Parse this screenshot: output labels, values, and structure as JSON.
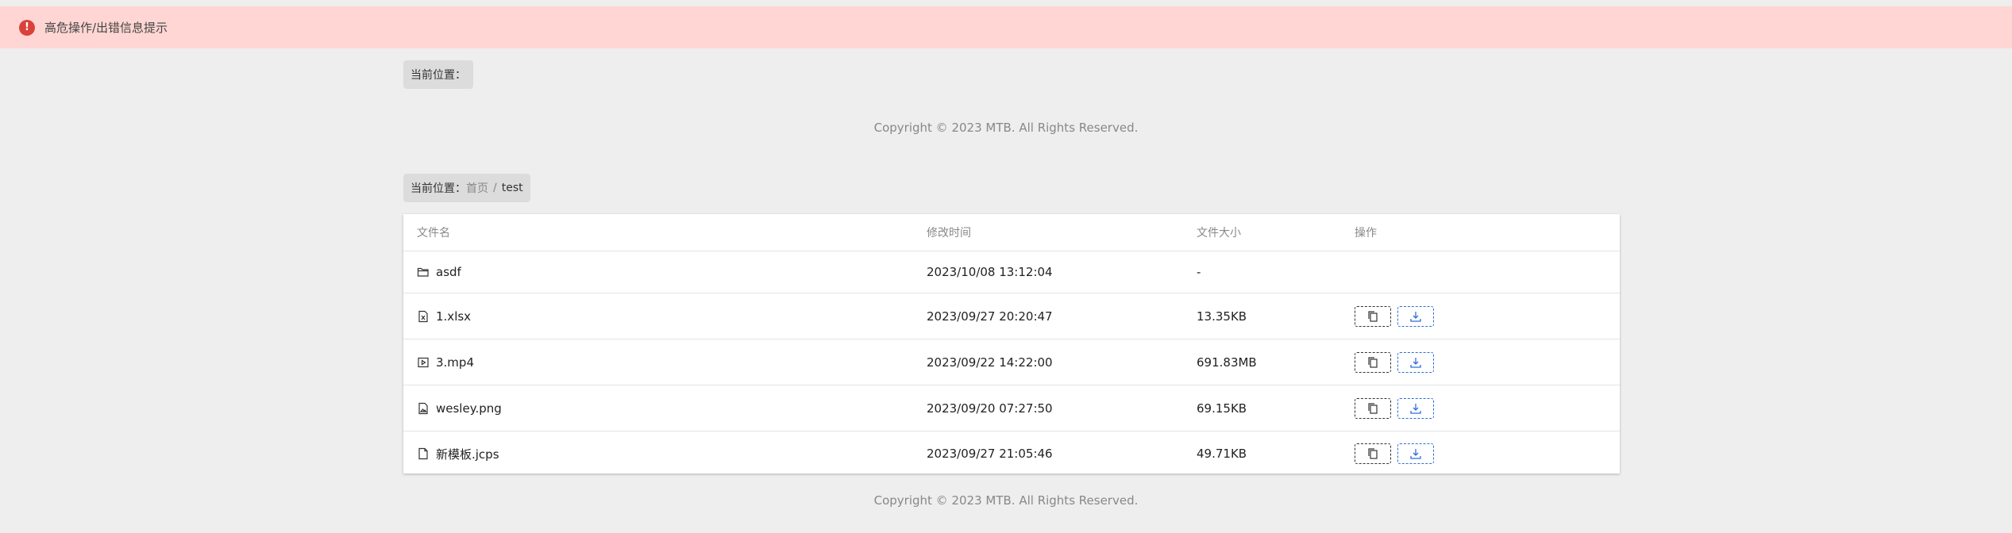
{
  "alert": {
    "text": "高危操作/出错信息提示",
    "icon": "exclamation-icon",
    "color": "#d9423a"
  },
  "top_breadcrumb": {
    "label": "当前位置："
  },
  "copyright_top": "Copyright © 2023 MTB. All Rights Reserved.",
  "breadcrumb": {
    "label": "当前位置：",
    "home": "首页",
    "separator": "/",
    "current": "test"
  },
  "table": {
    "headers": {
      "name": "文件名",
      "time": "修改时间",
      "size": "文件大小",
      "ops": "操作"
    },
    "rows": [
      {
        "name": "asdf",
        "time": "2023/10/08 13:12:04",
        "size": "-",
        "icon": "folder-icon"
      },
      {
        "name": "1.xlsx",
        "time": "2023/09/27 20:20:47",
        "size": "13.35KB",
        "icon": "file-excel-icon"
      },
      {
        "name": "3.mp4",
        "time": "2023/09/22 14:22:00",
        "size": "691.83MB",
        "icon": "file-video-icon"
      },
      {
        "name": "wesley.png",
        "time": "2023/09/20 07:27:50",
        "size": "69.15KB",
        "icon": "file-image-icon"
      },
      {
        "name": "新模板.jcps",
        "time": "2023/09/27 21:05:46",
        "size": "49.71KB",
        "icon": "file-icon"
      }
    ]
  },
  "copyright_bottom": "Copyright © 2023 MTB. All Rights Reserved.",
  "colors": {
    "alert_bg": "#ffd6d3",
    "download_accent": "#2f6fd6"
  }
}
